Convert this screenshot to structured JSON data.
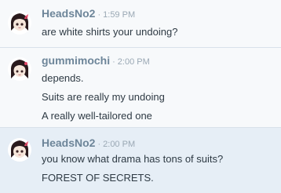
{
  "messages": [
    {
      "username": "HeadsNo2",
      "separator": "·",
      "timestamp": "1:59 PM",
      "lines": [
        "are white shirts your undoing?"
      ]
    },
    {
      "username": "gummimochi",
      "separator": "·",
      "timestamp": "2:00 PM",
      "lines": [
        "depends.",
        "Suits are really my undoing",
        "A really well-tailored one"
      ]
    },
    {
      "username": "HeadsNo2",
      "separator": "·",
      "timestamp": "2:00 PM",
      "lines": [
        "you know what drama has tons of suits?",
        "FOREST OF SECRETS."
      ]
    }
  ],
  "colors": {
    "username": "#6d8599",
    "timestamp": "#9aa8b4",
    "text": "#2e3a44",
    "row_light": "#f7f9fb",
    "row_blue": "#e6eef6",
    "hair": "#2a1a1c",
    "ribbon": "#e54b6a",
    "skin": "#f6e6da"
  },
  "icons": {
    "avatar": "anime-girl-avatar-icon"
  }
}
